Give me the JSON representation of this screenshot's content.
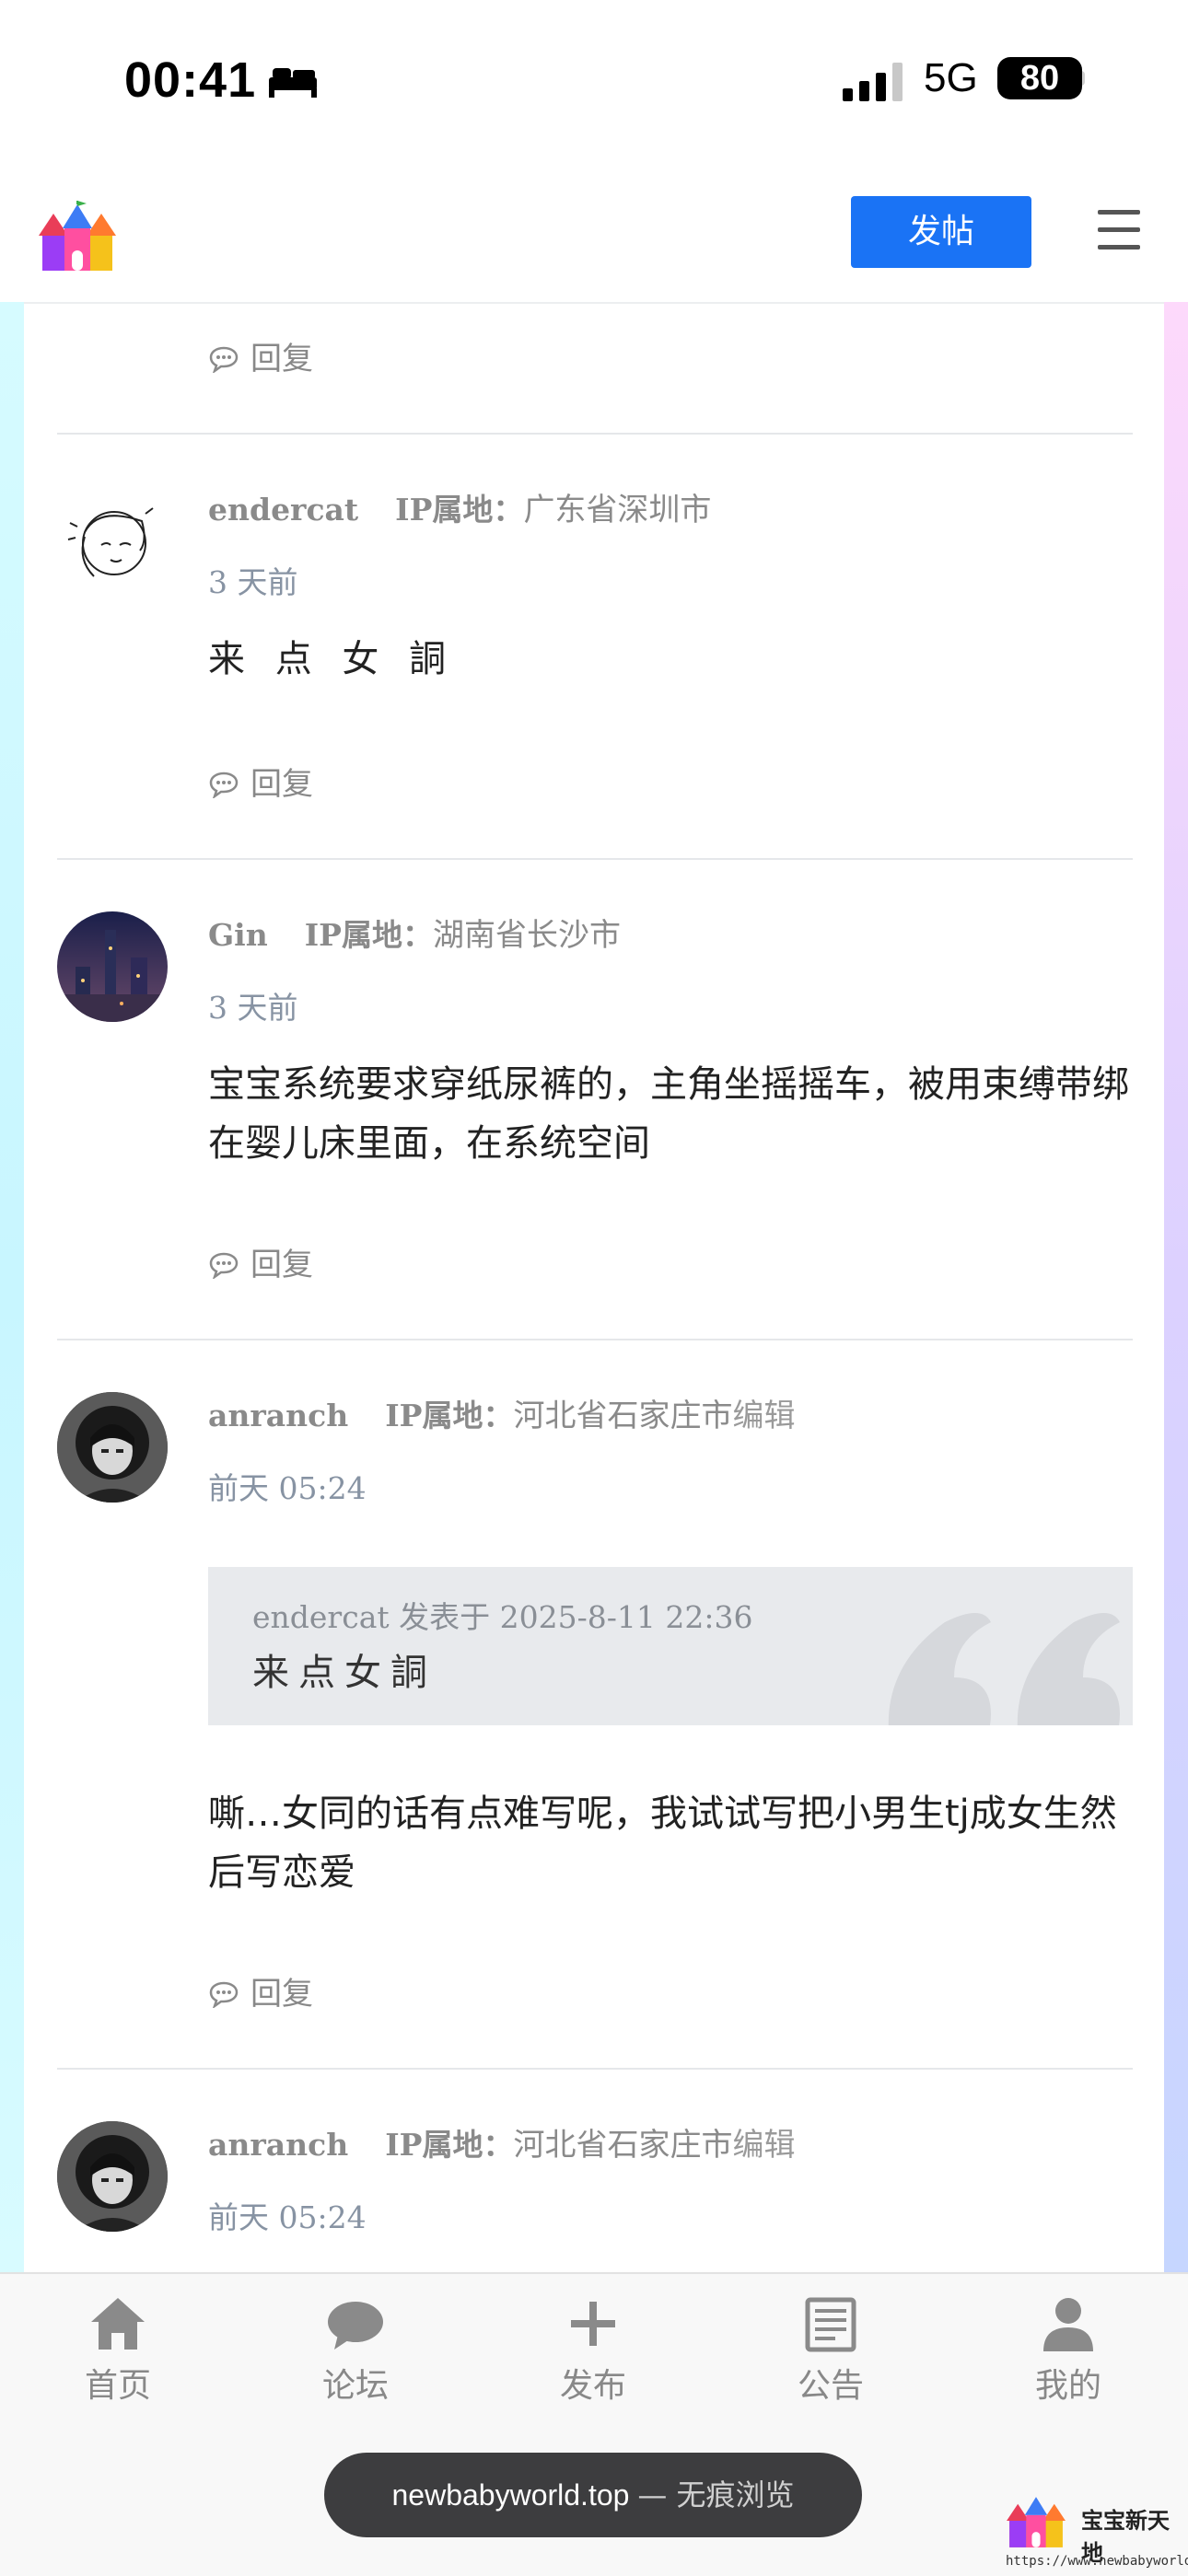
{
  "status_bar": {
    "time": "00:41",
    "network": "5G",
    "battery": "80"
  },
  "header": {
    "post_button": "发帖"
  },
  "comments": {
    "c0": {
      "reply": "回复"
    },
    "c1": {
      "user": "endercat",
      "ip_label": "IP属地：",
      "ip": "广东省深圳市",
      "time": "3 天前",
      "text": "来 点 女 詷",
      "reply": "回复"
    },
    "c2": {
      "user": "Gin",
      "ip_label": "IP属地：",
      "ip": "湖南省长沙市",
      "time": "3 天前",
      "text": "宝宝系统要求穿纸尿裤的，主角坐摇摇车，被用束缚带绑在婴儿床里面，在系统空间",
      "reply": "回复"
    },
    "c3": {
      "user": "anranch",
      "ip_label": "IP属地：",
      "ip": "河北省石家庄市",
      "edit": "编辑",
      "time": "前天 05:24",
      "quote_header": "endercat 发表于 2025-8-11 22:36",
      "quote_text": "来点女詷",
      "text": "嘶…女同的话有点难写呢，我试试写把小男生tj成女生然后写恋爱",
      "reply": "回复"
    },
    "c4": {
      "user": "anranch",
      "ip_label": "IP属地：",
      "ip": "河北省石家庄市",
      "edit": "编辑",
      "time": "前天 05:24"
    }
  },
  "tabbar": {
    "tabs": [
      {
        "label": "首页",
        "icon": "home-icon"
      },
      {
        "label": "论坛",
        "icon": "chat-bubble-icon"
      },
      {
        "label": "发布",
        "icon": "plus-icon"
      },
      {
        "label": "公告",
        "icon": "newspaper-icon"
      },
      {
        "label": "我的",
        "icon": "user-icon"
      }
    ]
  },
  "browser": {
    "url": "newbabyworld.top",
    "mode": "— 无痕浏览"
  },
  "watermark": {
    "title": "宝宝新天地",
    "url": "https://www.newbabyworld.top"
  },
  "colors": {
    "accent": "#1a73f5",
    "tab_gray": "#888888"
  }
}
